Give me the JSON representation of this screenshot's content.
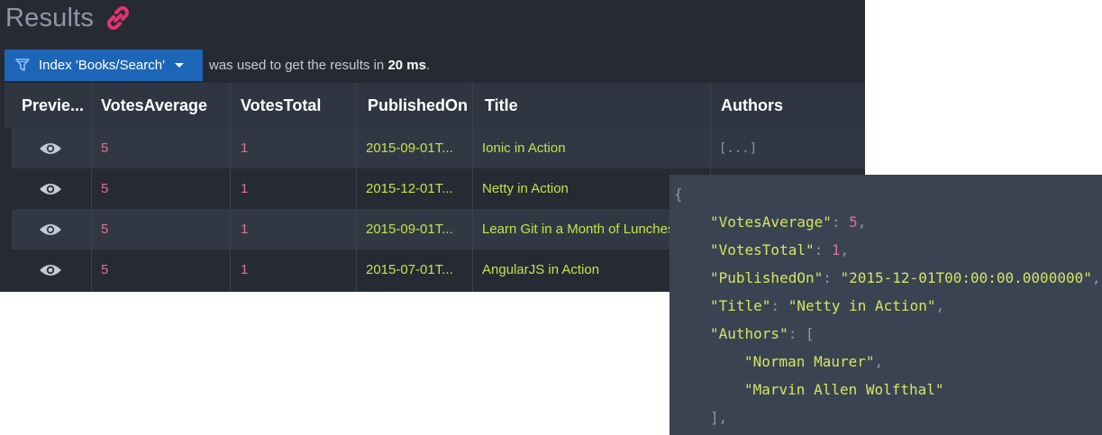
{
  "header": {
    "title": "Results"
  },
  "index_bar": {
    "index_label": "Index 'Books/Search'",
    "note_prefix": "was used to get the results in",
    "duration": "20 ms",
    "note_suffix": "."
  },
  "table": {
    "columns": [
      "Previe...",
      "VotesAverage",
      "VotesTotal",
      "PublishedOn",
      "Title",
      "Authors"
    ],
    "rows": [
      {
        "votes_average": "5",
        "votes_total": "1",
        "published_on": "2015-09-01T...",
        "title": "Ionic in Action",
        "authors": "[...]"
      },
      {
        "votes_average": "5",
        "votes_total": "1",
        "published_on": "2015-12-01T...",
        "title": "Netty in Action",
        "authors": ""
      },
      {
        "votes_average": "5",
        "votes_total": "1",
        "published_on": "2015-09-01T...",
        "title": "Learn Git in a Month of Lunches",
        "authors": ""
      },
      {
        "votes_average": "5",
        "votes_total": "1",
        "published_on": "2015-07-01T...",
        "title": "AngularJS in Action",
        "authors": ""
      }
    ]
  },
  "json_preview": {
    "open_brace": "{",
    "votes_average_key": "\"VotesAverage\"",
    "votes_average_value": "5",
    "votes_total_key": "\"VotesTotal\"",
    "votes_total_value": "1",
    "published_on_key": "\"PublishedOn\"",
    "published_on_value": "\"2015-12-01T00:00:00.0000000\"",
    "title_key": "\"Title\"",
    "title_value": "\"Netty in Action\"",
    "authors_key": "\"Authors\"",
    "authors_open": "[",
    "author_1": "\"Norman Maurer\"",
    "author_2": "\"Marvin Allen Wolfthal\"",
    "authors_close": "],"
  },
  "colors": {
    "panel_bg": "#262a33",
    "header_bg": "#2f3541",
    "accent_blue": "#1d65b6",
    "link_pink": "#e8336e",
    "number_pink": "#e0709a",
    "string_green": "#c4e34a",
    "popup_bg": "#3a4352"
  },
  "icons": {
    "title_icon": "link-icon",
    "index_icon": "filter-icon",
    "preview_icon": "eye-icon",
    "dropdown_icon": "caret-down-icon"
  }
}
